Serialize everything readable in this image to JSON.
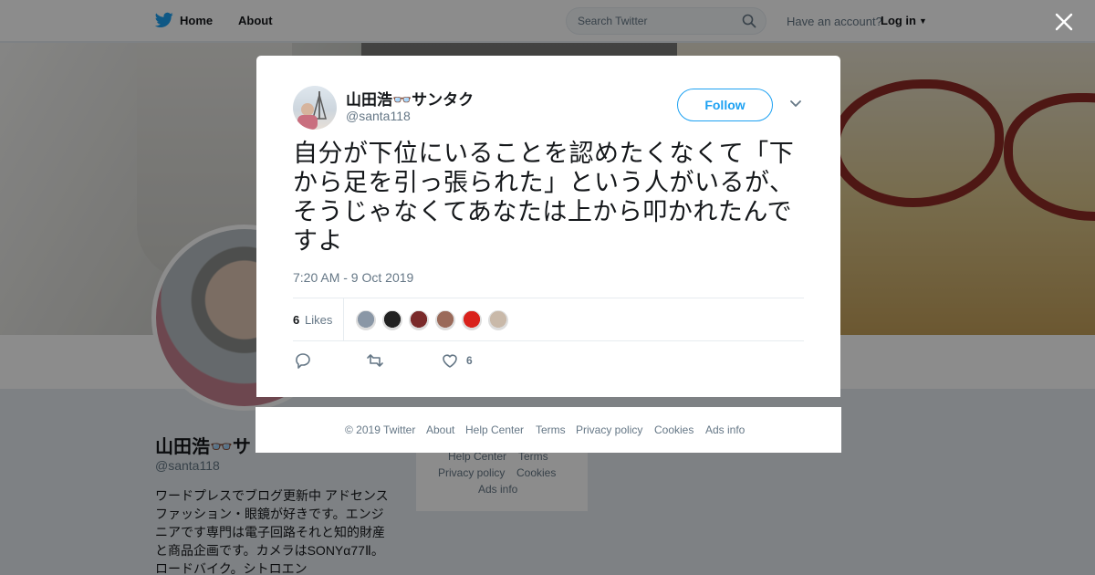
{
  "nav": {
    "home": "Home",
    "about": "About"
  },
  "search": {
    "placeholder": "Search Twitter"
  },
  "account": {
    "question": "Have an account?",
    "login": "Log in"
  },
  "profile": {
    "name": "山田浩👓サ",
    "handle": "@santa118",
    "bio": "ワードプレスでブログ更新中 アドセンス　ファッション・眼鏡が好きです。エンジニアです専門は電子回路それと知的財産と商品企画です。カメラはSONYα77Ⅱ。ロードバイク。シトロエン"
  },
  "bg_footer": {
    "help": "Help Center",
    "terms": "Terms",
    "privacy": "Privacy policy",
    "cookies": "Cookies",
    "ads": "Ads info"
  },
  "tweet": {
    "author_name": "山田浩👓サンタク",
    "author_handle": "@santa118",
    "follow_label": "Follow",
    "text": "自分が下位にいることを認めたくなくて「下から足を引っ張られた」という人がいるが、そうじゃなくてあなたは上から叩かれたんですよ",
    "timestamp": "7:20 AM - 9 Oct 2019",
    "likes_count": "6",
    "likes_label": "Likes",
    "action_like_count": "6",
    "liker_colors": [
      "#8a97a6",
      "#222222",
      "#7a2a2a",
      "#9a6a5a",
      "#d9221c",
      "#c9b9a9"
    ]
  },
  "footer": {
    "copyright": "© 2019 Twitter",
    "about": "About",
    "help": "Help Center",
    "terms": "Terms",
    "privacy": "Privacy policy",
    "cookies": "Cookies",
    "ads": "Ads info"
  },
  "colors": {
    "accent": "#1da1f2",
    "text": "#14171a",
    "muted": "#657786",
    "overlay": "rgba(0,0,0,0.45)"
  }
}
